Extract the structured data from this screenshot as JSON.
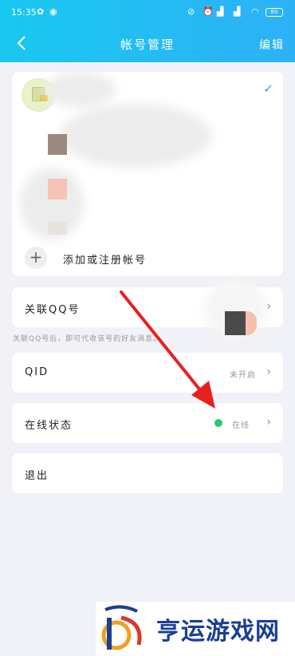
{
  "status_bar": {
    "time": "15:35",
    "battery": "80"
  },
  "nav": {
    "title": "帐号管理",
    "edit": "编辑"
  },
  "accounts": {
    "add_label": "添加或注册帐号",
    "swatch_colors": [
      "#9b8a7f",
      "#f6c3b6",
      "#e6e4dc"
    ]
  },
  "linked_qq": {
    "label": "关联QQ号",
    "hint": "关联QQ号后，即可代收该号的好友消息。"
  },
  "qid": {
    "label": "QID",
    "value": "未开启"
  },
  "online_status": {
    "label": "在线状态",
    "value": "在线",
    "dot_color": "#2ec96a"
  },
  "logout": {
    "label": "退出"
  },
  "watermark": {
    "text": "亨运游戏网"
  }
}
